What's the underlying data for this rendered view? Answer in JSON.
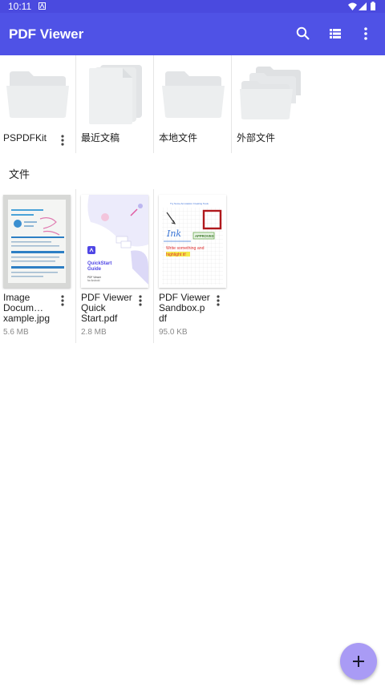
{
  "status_bar": {
    "time": "10:11"
  },
  "app_bar": {
    "title": "PDF Viewer",
    "icons": [
      "search-icon",
      "list-view-icon",
      "more-vert-icon"
    ]
  },
  "folders": [
    {
      "label": "PSPDFKit",
      "icon": "folder-icon",
      "has_menu": true
    },
    {
      "label": "最近文稿",
      "icon": "documents-icon",
      "has_menu": false
    },
    {
      "label": "本地文件",
      "icon": "folder-icon",
      "has_menu": false
    },
    {
      "label": "外部文件",
      "icon": "folders-icon",
      "has_menu": false
    }
  ],
  "files_section": {
    "title": "文件"
  },
  "files": [
    {
      "name_lines": [
        "Image",
        "Docum…",
        "xample.jpg"
      ],
      "size": "5.6 MB"
    },
    {
      "name_lines": [
        "PDF Viewer",
        "Quick",
        "Start.pdf"
      ],
      "size": "2.8 MB",
      "thumb": {
        "title1": "QuickStart",
        "title2": "Guide",
        "sub1": "PDF Viewer",
        "sub2": "for Android"
      }
    },
    {
      "name_lines": [
        "PDF Viewer",
        "Sandbox.p",
        "df"
      ],
      "size": "95.0 KB",
      "thumb": {
        "header": "Try Some Annotation Creating Tools",
        "ink": "Ink",
        "stamp": "APPROVED",
        "text1": "Write something and",
        "text2": "highlight it!"
      }
    }
  ],
  "fab": {
    "icon": "plus-icon"
  },
  "colors": {
    "app_bar": "#4f52e6",
    "status_bar": "#4a4adf",
    "fab": "#a99bf5"
  }
}
